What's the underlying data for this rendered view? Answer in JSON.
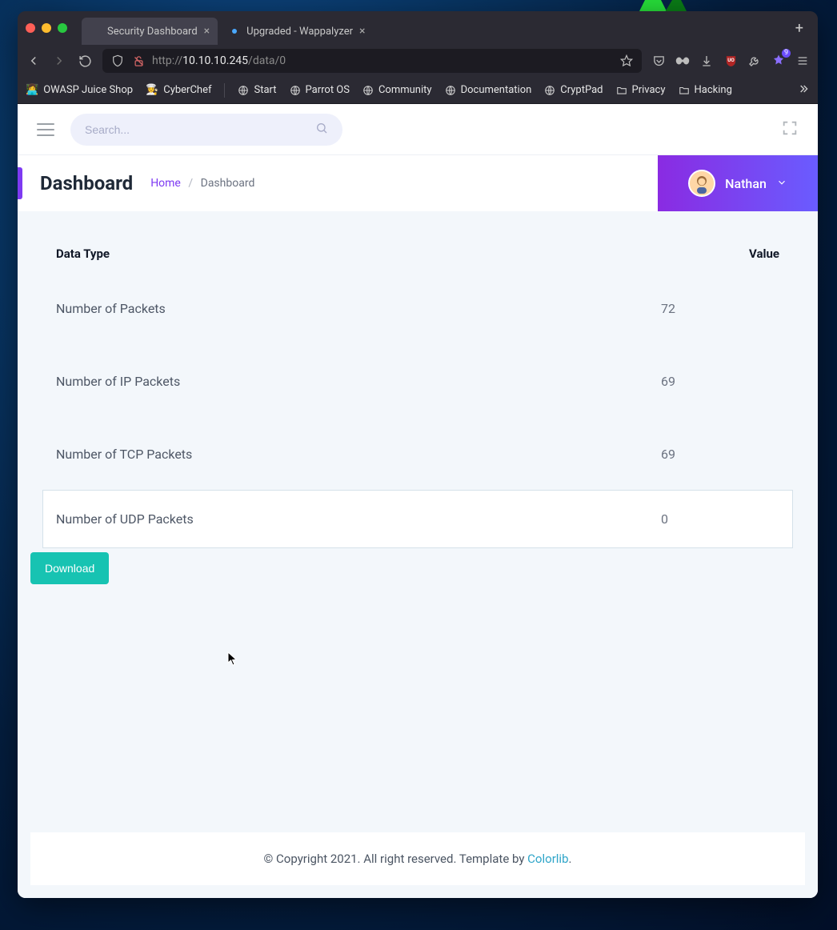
{
  "browser": {
    "tabs": [
      {
        "title": "Security Dashboard",
        "active": true,
        "favicon": "blank"
      },
      {
        "title": "Upgraded - Wappalyzer",
        "active": false,
        "favicon": "dot-blue"
      }
    ],
    "url": {
      "scheme": "http://",
      "host": "10.10.10.245",
      "path": "/data/0"
    },
    "ext_badge": "9",
    "bookmarks": [
      {
        "label": "OWASP Juice Shop",
        "icon": "emoji",
        "emoji": "👩‍💻"
      },
      {
        "label": "CyberChef",
        "icon": "emoji",
        "emoji": "👩‍🍳"
      },
      {
        "label": "Start",
        "icon": "globe"
      },
      {
        "label": "Parrot OS",
        "icon": "globe"
      },
      {
        "label": "Community",
        "icon": "globe"
      },
      {
        "label": "Documentation",
        "icon": "globe"
      },
      {
        "label": "CryptPad",
        "icon": "globe"
      },
      {
        "label": "Privacy",
        "icon": "folder"
      },
      {
        "label": "Hacking",
        "icon": "folder"
      }
    ]
  },
  "app": {
    "search_placeholder": "Search...",
    "page_title": "Dashboard",
    "breadcrumb": {
      "home": "Home",
      "current": "Dashboard"
    },
    "user": {
      "name": "Nathan"
    },
    "table": {
      "head": {
        "type": "Data Type",
        "value": "Value"
      },
      "rows": [
        {
          "label": "Number of Packets",
          "value": "72"
        },
        {
          "label": "Number of IP Packets",
          "value": "69"
        },
        {
          "label": "Number of TCP Packets",
          "value": "69"
        },
        {
          "label": "Number of UDP Packets",
          "value": "0",
          "hovered": true
        }
      ]
    },
    "download_label": "Download",
    "footer": {
      "text": "© Copyright 2021. All right reserved. Template by ",
      "link": "Colorlib",
      "suffix": "."
    }
  }
}
